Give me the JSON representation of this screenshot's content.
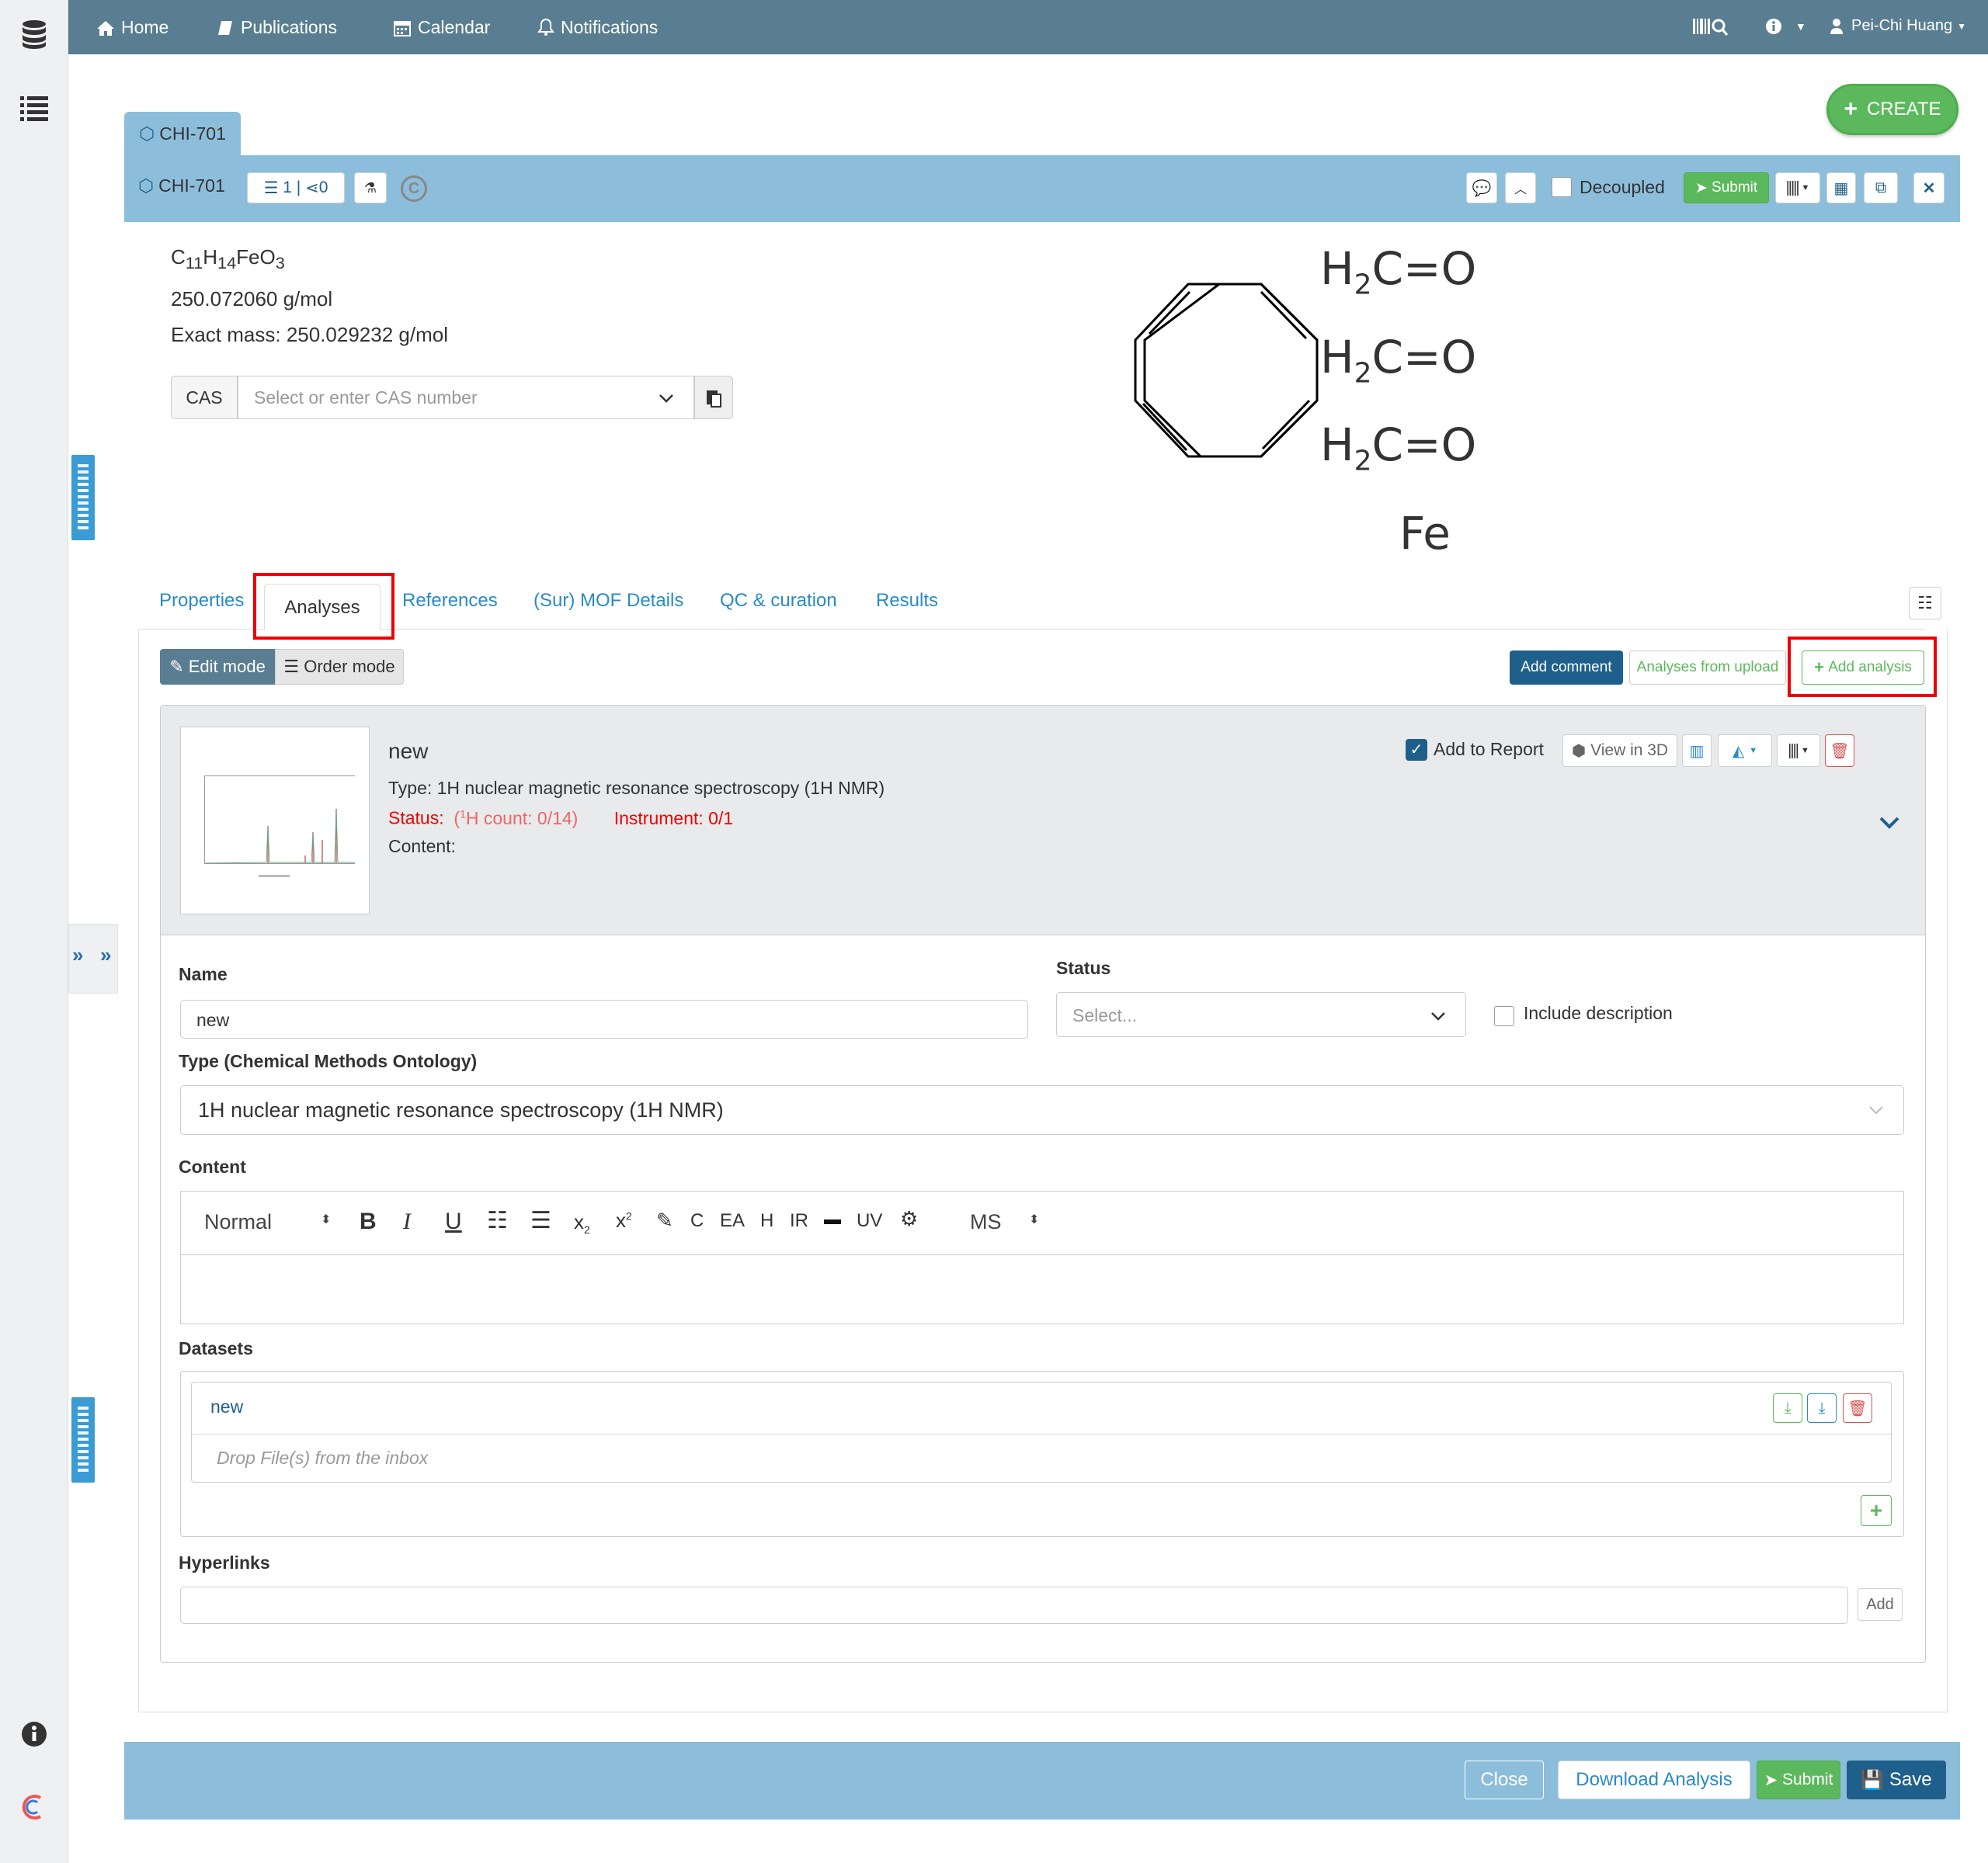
{
  "nav": {
    "home": "Home",
    "publications": "Publications",
    "calendar": "Calendar",
    "notifications": "Notifications",
    "user": "Pei-Chi Huang"
  },
  "create_label": "CREATE",
  "sample_tab": "CHI-701",
  "header": {
    "title": "CHI-701",
    "counter_list": "1",
    "counter_share": "0",
    "decoupled_label": "Decoupled",
    "submit_label": "Submit"
  },
  "molecule": {
    "formula_parts": [
      "C",
      "11",
      "H",
      "14",
      "FeO",
      "3"
    ],
    "molar_mass": "250.072060 g/mol",
    "exact_mass": "Exact mass: 250.029232 g/mol",
    "cas_label": "CAS",
    "cas_placeholder": "Select or enter CAS number",
    "structure_lines": [
      "H2C=O",
      "H2C=O",
      "H2C=O"
    ],
    "metal": "Fe"
  },
  "tabs": [
    "Properties",
    "Analyses",
    "References",
    "(Sur) MOF Details",
    "QC & curation",
    "Results"
  ],
  "modes": {
    "edit": "Edit mode",
    "order": "Order mode"
  },
  "actions": {
    "add_comment": "Add comment",
    "from_upload": "Analyses from upload",
    "add_analysis": "Add analysis"
  },
  "analysis": {
    "name": "new",
    "type_line": "Type: 1H nuclear magnetic resonance spectroscopy (1H NMR)",
    "status_label": "Status:",
    "status_detail_pre": "(",
    "status_detail_sup": "1",
    "status_detail_post": "H count: 0/14)",
    "instrument": "Instrument: 0/1",
    "content_label": "Content:",
    "add_to_report": "Add to Report",
    "view_3d": "View in 3D"
  },
  "form": {
    "name_label": "Name",
    "name_value": "new",
    "status_label": "Status",
    "status_placeholder": "Select...",
    "include_desc": "Include description",
    "type_label": "Type (Chemical Methods Ontology)",
    "type_value": "1H nuclear magnetic resonance spectroscopy (1H NMR)",
    "content_label": "Content",
    "toolbar": {
      "style": "Normal",
      "bold": "B",
      "italic": "I",
      "underline": "U",
      "sub": "x",
      "sub_idx": "2",
      "sup": "x",
      "sup_idx": "2",
      "c": "C",
      "ea": "EA",
      "h": "H",
      "ir": "IR",
      "uv": "UV",
      "ms": "MS"
    },
    "datasets_label": "Datasets",
    "dataset_name": "new",
    "drop_hint": "Drop File(s) from the inbox",
    "hyperlinks_label": "Hyperlinks",
    "add_label": "Add"
  },
  "footer": {
    "close": "Close",
    "download": "Download Analysis",
    "submit": "Submit",
    "save": "Save"
  },
  "colors": {
    "topbar": "#5a7e91",
    "header": "#8cbedb",
    "green": "#5cb85c",
    "blue_dark": "#1f5f8b",
    "red": "#e00000"
  }
}
